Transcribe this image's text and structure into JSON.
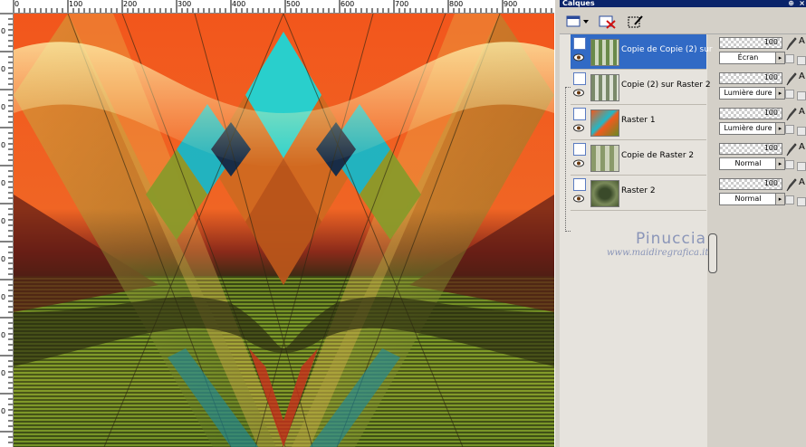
{
  "ruler": {
    "top_labels": [
      "0",
      "100",
      "200",
      "300",
      "400",
      "500",
      "600",
      "700",
      "800",
      "900"
    ],
    "left_labels": [
      "0",
      "0",
      "0",
      "0",
      "0",
      "0",
      "0",
      "0",
      "0",
      "0",
      "0"
    ]
  },
  "panel": {
    "title": "Calques",
    "pin_glyph": "⊕",
    "close_glyph": "×"
  },
  "layers": [
    {
      "name": "Copie de Copie (2) sur",
      "opacity": "100",
      "blend": "Écran",
      "lock": "A",
      "selected": true
    },
    {
      "name": "Copie (2) sur Raster 2",
      "opacity": "100",
      "blend": "Lumière dure",
      "lock": "A",
      "selected": false
    },
    {
      "name": "Raster 1",
      "opacity": "100",
      "blend": "Lumière dure",
      "lock": "A",
      "selected": false
    },
    {
      "name": "Copie de Raster 2",
      "opacity": "100",
      "blend": "Normal",
      "lock": "A",
      "selected": false
    },
    {
      "name": "Raster 2",
      "opacity": "100",
      "blend": "Normal",
      "lock": "A",
      "selected": false
    }
  ],
  "watermark": {
    "name": "Pinuccia",
    "url": "www.maidiregrafica.it"
  },
  "colors": {
    "selection": "#316ac5",
    "title_bar": "#0a246a",
    "canvas_orange": "#f05a1e",
    "accent_cyan": "#22e6e6",
    "accent_green": "#8a9a2a"
  }
}
